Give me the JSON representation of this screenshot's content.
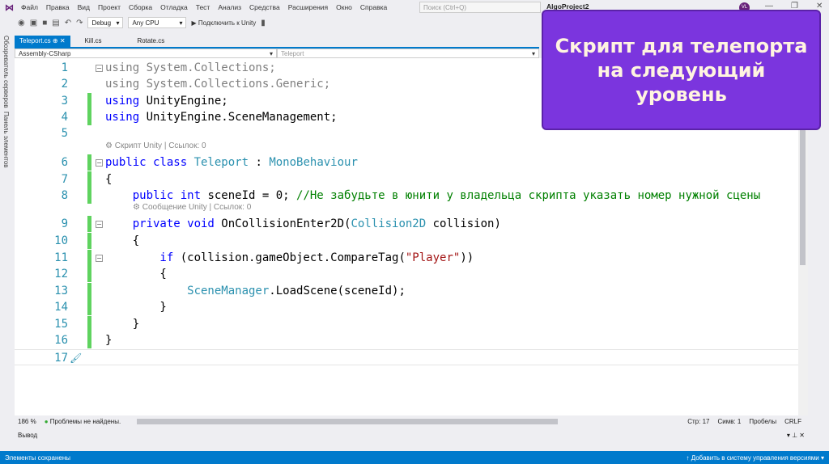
{
  "menu": [
    "Файл",
    "Правка",
    "Вид",
    "Проект",
    "Сборка",
    "Отладка",
    "Тест",
    "Анализ",
    "Средства",
    "Расширения",
    "Окно",
    "Справка"
  ],
  "search_placeholder": "Поиск (Ctrl+Q)",
  "project": "AlgoProject2",
  "avatar": "VL",
  "toolbar": {
    "config": "Debug",
    "platform": "Any CPU",
    "attach": "▶ Подключить к Unity"
  },
  "left_panels": [
    "Обозреватель серверов",
    "Панель элементов"
  ],
  "tabs": [
    "Teleport.cs",
    "Kill.cs",
    "Rotate.cs"
  ],
  "nav": {
    "project": "Assembly-CSharp",
    "class": "Teleport"
  },
  "code": [
    {
      "n": "1",
      "tokens": [
        {
          "t": "using System.Collections;",
          "c": "g"
        }
      ]
    },
    {
      "n": "2",
      "tokens": [
        {
          "t": "using System.Collections.Generic;",
          "c": "g"
        }
      ]
    },
    {
      "n": "3",
      "tokens": [
        {
          "t": "using ",
          "c": "k"
        },
        {
          "t": "UnityEngine;",
          "c": "p"
        }
      ]
    },
    {
      "n": "4",
      "tokens": [
        {
          "t": "using ",
          "c": "k"
        },
        {
          "t": "UnityEngine.SceneManagement;",
          "c": "p"
        }
      ]
    },
    {
      "n": "5",
      "tokens": []
    },
    {
      "n": "6",
      "tokens": [
        {
          "t": "public class ",
          "c": "k"
        },
        {
          "t": "Teleport",
          "c": "t"
        },
        {
          "t": " : ",
          "c": "p"
        },
        {
          "t": "MonoBehaviour",
          "c": "t"
        }
      ]
    },
    {
      "n": "7",
      "tokens": [
        {
          "t": "{",
          "c": "p"
        }
      ]
    },
    {
      "n": "8",
      "tokens": [
        {
          "t": "    public int ",
          "c": "k"
        },
        {
          "t": "sceneId = 0; ",
          "c": "p"
        },
        {
          "t": "//Не забудьте в юнити у владельца скрипта указать номер нужной сцены",
          "c": "c"
        }
      ]
    },
    {
      "n": "9",
      "tokens": [
        {
          "t": "    private void ",
          "c": "k"
        },
        {
          "t": "OnCollisionEnter2D(",
          "c": "p"
        },
        {
          "t": "Collision2D",
          "c": "t"
        },
        {
          "t": " collision)",
          "c": "p"
        }
      ]
    },
    {
      "n": "10",
      "tokens": [
        {
          "t": "    {",
          "c": "p"
        }
      ]
    },
    {
      "n": "11",
      "tokens": [
        {
          "t": "        if ",
          "c": "k"
        },
        {
          "t": "(collision.gameObject.CompareTag(",
          "c": "p"
        },
        {
          "t": "\"Player\"",
          "c": "s"
        },
        {
          "t": "))",
          "c": "p"
        }
      ]
    },
    {
      "n": "12",
      "tokens": [
        {
          "t": "        {",
          "c": "p"
        }
      ]
    },
    {
      "n": "13",
      "tokens": [
        {
          "t": "            SceneManager",
          "c": "t"
        },
        {
          "t": ".LoadScene(sceneId);",
          "c": "p"
        }
      ]
    },
    {
      "n": "14",
      "tokens": [
        {
          "t": "        }",
          "c": "p"
        }
      ]
    },
    {
      "n": "15",
      "tokens": [
        {
          "t": "    }",
          "c": "p"
        }
      ]
    },
    {
      "n": "16",
      "tokens": [
        {
          "t": "}",
          "c": "p"
        }
      ]
    },
    {
      "n": "17",
      "tokens": []
    }
  ],
  "codelens": [
    "Скрипт Unity | Ссылок: 0",
    "Сообщение Unity | Ссылок: 0"
  ],
  "editor_status": {
    "zoom": "186 %",
    "problems": "Проблемы не найдены.",
    "line": "Стр: 17",
    "col": "Симв: 1",
    "spaces": "Пробелы",
    "eol": "CRLF"
  },
  "output_title": "Вывод",
  "status": {
    "left": "Элементы сохранены",
    "right": "↑ Добавить в систему управления версиями ▾"
  },
  "overlay": {
    "lines": [
      "Скрипт для телепорта",
      "на следующий",
      "уровень"
    ]
  }
}
